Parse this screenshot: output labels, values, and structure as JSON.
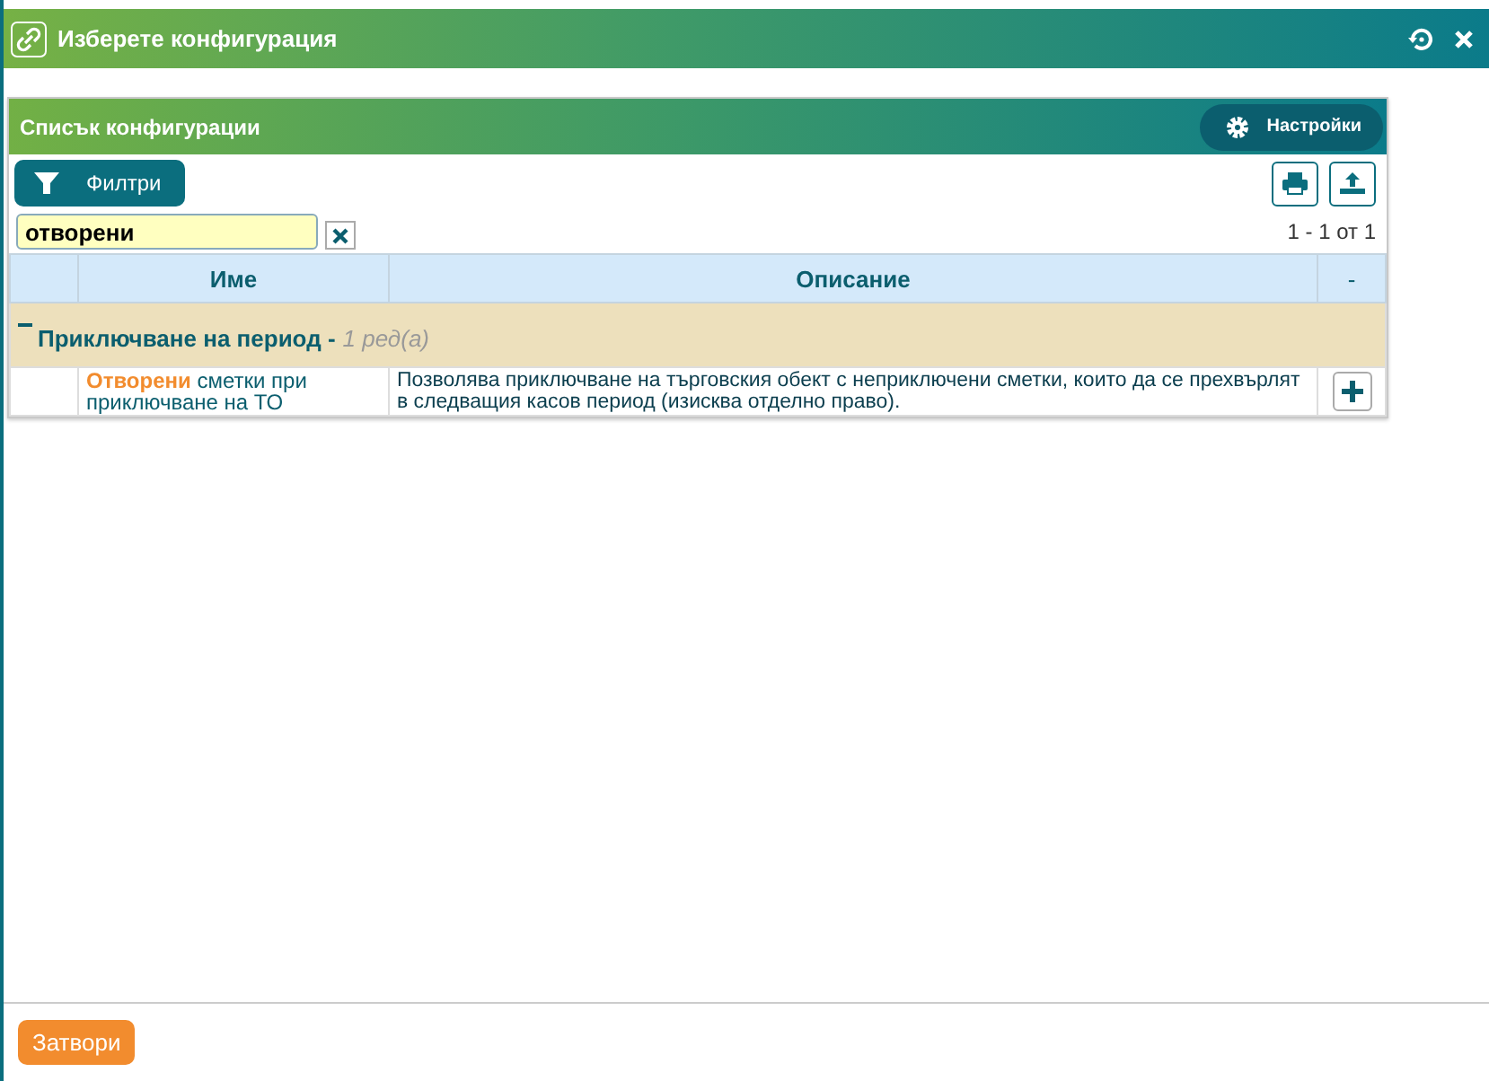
{
  "window": {
    "title": "Изберете конфигурация"
  },
  "panel": {
    "title": "Списък конфигурации",
    "settings_button": "Настройки",
    "filter_button": "Филтри",
    "search": {
      "value": "отворени"
    },
    "pager": "1 - 1 от 1"
  },
  "table": {
    "columns": [
      "Име",
      "Описание",
      "-"
    ],
    "groups": [
      {
        "title": "Приключване на период -",
        "count": "1 ред(а)",
        "expanded": true,
        "rows": [
          {
            "name_match": "Отворени",
            "name_rest": " сметки при приключване на ТО",
            "description": "Позволява приключване на търговския обект с неприключени сметки, които да се прехвърлят в следващия касов период (изисква отделно право)."
          }
        ]
      }
    ]
  },
  "footer": {
    "close_button": "Затвори"
  }
}
